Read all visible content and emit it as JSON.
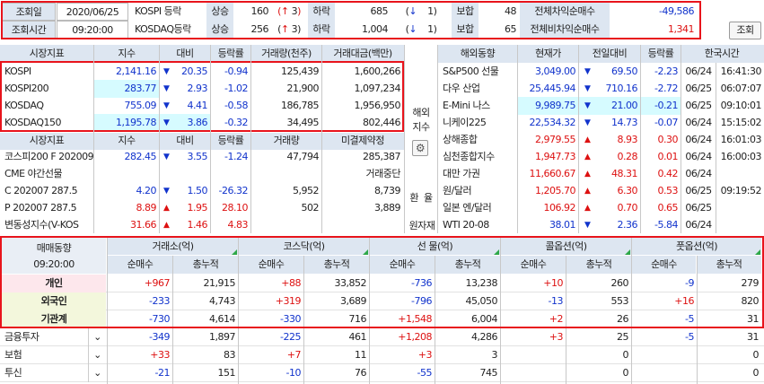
{
  "top": {
    "date_label": "조회일",
    "date": "2020/06/25",
    "time_label": "조회시간",
    "time": "09:20:00",
    "rows": [
      {
        "name": "KOSPI 등락",
        "up_label": "상승",
        "up": "160",
        "limit_up": "3",
        "down_label": "하락",
        "down": "685",
        "limit_down": "1",
        "flat_label": "보합",
        "flat": "48",
        "arb_label": "전체차익순매수",
        "arb": "-49,586"
      },
      {
        "name": "KOSDAQ등락",
        "up_label": "상승",
        "up": "256",
        "limit_up": "3",
        "down_label": "하락",
        "down": "1,004",
        "limit_down": "1",
        "flat_label": "보합",
        "flat": "65",
        "arb_label": "전체비차익순매수",
        "arb": "1,341"
      }
    ],
    "query_btn": "조회"
  },
  "idx": {
    "headers": [
      "시장지표",
      "지수",
      "대비",
      "등락률",
      "거래량(천주)",
      "거래대금(백만)"
    ],
    "rows": [
      {
        "name": "KOSPI",
        "val": "2,141.16",
        "chg": "20.35",
        "rate": "-0.94",
        "vol": "125,439",
        "amt": "1,600,266"
      },
      {
        "name": "KOSPI200",
        "val": "283.77",
        "chg": "2.93",
        "rate": "-1.02",
        "vol": "21,900",
        "amt": "1,097,234"
      },
      {
        "name": "KOSDAQ",
        "val": "755.09",
        "chg": "4.41",
        "rate": "-0.58",
        "vol": "186,785",
        "amt": "1,956,950"
      },
      {
        "name": "KOSDAQ150",
        "val": "1,195.78",
        "chg": "3.86",
        "rate": "-0.32",
        "vol": "34,495",
        "amt": "802,446"
      }
    ]
  },
  "fut": {
    "headers": [
      "시장지표",
      "지수",
      "대비",
      "등락률",
      "거래량",
      "미결제약정"
    ],
    "rows": [
      {
        "name": "코스피200 F 202009",
        "val": "282.45",
        "dir": "down",
        "chg": "3.55",
        "rate": "-1.24",
        "vol": "47,794",
        "oi": "285,387"
      },
      {
        "name": "CME 야간선물",
        "val": "",
        "dir": "",
        "chg": "",
        "rate": "",
        "vol": "",
        "oi": "거래중단"
      },
      {
        "name": "C 202007 287.5",
        "val": "4.20",
        "dir": "down",
        "chg": "1.50",
        "rate": "-26.32",
        "vol": "5,952",
        "oi": "8,739"
      },
      {
        "name": "P 202007 287.5",
        "val": "8.89",
        "dir": "up",
        "chg": "1.95",
        "rate": "28.10",
        "vol": "502",
        "oi": "3,889"
      },
      {
        "name": "변동성지수(V-KOS",
        "val": "31.66",
        "dir": "up",
        "chg": "1.46",
        "rate": "4.83",
        "vol": "",
        "oi": ""
      }
    ]
  },
  "side": {
    "overseas_btn1": "해외",
    "overseas_btn2": "지수",
    "gear": "⚙",
    "fx_btn1": "환",
    "fx_btn2": "율",
    "raw_btn": "원자재"
  },
  "world": {
    "headers": [
      "해외동향",
      "현재가",
      "전일대비",
      "등락률",
      "한국시간"
    ],
    "rows": [
      {
        "name": "S&P500 선물",
        "price": "3,049.00",
        "dir": "down",
        "chg": "69.50",
        "rate": "-2.23",
        "date": "06/24",
        "time": "16:41:30"
      },
      {
        "name": "다우 산업",
        "price": "25,445.94",
        "dir": "down",
        "chg": "710.16",
        "rate": "-2.72",
        "date": "06/25",
        "time": "06:07:07"
      },
      {
        "name": "E-Mini 나스",
        "price": "9,989.75",
        "dir": "down",
        "chg": "21.00",
        "rate": "-0.21",
        "date": "06/25",
        "time": "09:10:01"
      },
      {
        "name": "니케이225",
        "price": "22,534.32",
        "dir": "down",
        "chg": "14.73",
        "rate": "-0.07",
        "date": "06/24",
        "time": "15:15:02"
      },
      {
        "name": "상해종합",
        "price": "2,979.55",
        "dir": "up",
        "chg": "8.93",
        "rate": "0.30",
        "date": "06/24",
        "time": "16:01:03"
      },
      {
        "name": "심천종합지수",
        "price": "1,947.73",
        "dir": "up",
        "chg": "0.28",
        "rate": "0.01",
        "date": "06/24",
        "time": "16:00:03"
      },
      {
        "name": "대만 가권",
        "price": "11,660.67",
        "dir": "up",
        "chg": "48.31",
        "rate": "0.42",
        "date": "06/24",
        "time": ""
      },
      {
        "name": "원/달러",
        "price": "1,205.70",
        "dir": "up",
        "chg": "6.30",
        "rate": "0.53",
        "date": "06/25",
        "time": "09:19:52"
      },
      {
        "name": "일본 엔/달러",
        "price": "106.92",
        "dir": "up",
        "chg": "0.70",
        "rate": "0.65",
        "date": "06/25",
        "time": ""
      },
      {
        "name": "WTI 20-08",
        "price": "38.01",
        "dir": "down",
        "chg": "2.36",
        "rate": "-5.84",
        "date": "06/24",
        "time": ""
      }
    ]
  },
  "trade": {
    "title": "매매동향",
    "time": "09:20:00",
    "groups": [
      "거래소(억)",
      "코스닥(억)",
      "선    물(억)",
      "콜옵션(억)",
      "풋옵션(억)"
    ],
    "sub": [
      "순매수",
      "총누적"
    ],
    "rows": [
      {
        "name": "개인",
        "v": [
          "+967",
          "21,915",
          "+88",
          "33,852",
          "-736",
          "13,238",
          "+10",
          "260",
          "-9",
          "279"
        ]
      },
      {
        "name": "외국인",
        "v": [
          "-233",
          "4,743",
          "+319",
          "3,689",
          "-796",
          "45,050",
          "-13",
          "553",
          "+16",
          "820"
        ]
      },
      {
        "name": "기관계",
        "v": [
          "-730",
          "4,614",
          "-330",
          "716",
          "+1,548",
          "6,004",
          "+2",
          "26",
          "-5",
          "31"
        ]
      },
      {
        "name": "금융투자",
        "v": [
          "-349",
          "1,897",
          "-225",
          "461",
          "+1,208",
          "4,286",
          "+3",
          "25",
          "-5",
          "31"
        ]
      },
      {
        "name": "보험",
        "v": [
          "+33",
          "83",
          "+7",
          "11",
          "+3",
          "3",
          "",
          "0",
          "",
          "0"
        ]
      },
      {
        "name": "투신",
        "v": [
          "-21",
          "151",
          "-10",
          "76",
          "-55",
          "745",
          "",
          "0",
          "",
          "0"
        ]
      }
    ]
  },
  "colors": {
    "up": "#dd1111",
    "down": "#1133cc",
    "header": "#dde6f1",
    "highlight": "#d6fbff",
    "box": "#e8141c"
  }
}
